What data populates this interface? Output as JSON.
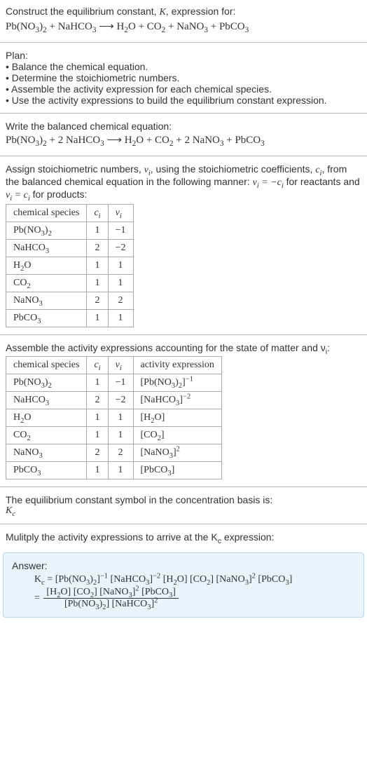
{
  "intro": {
    "line1_prefix": "Construct the equilibrium constant, ",
    "K": "K",
    "line1_suffix": ", expression for:",
    "equation": "Pb(NO<sub>3</sub>)<sub>2</sub> + NaHCO<sub>3</sub>  ⟶  H<sub>2</sub>O + CO<sub>2</sub> + NaNO<sub>3</sub> + PbCO<sub>3</sub>"
  },
  "plan": {
    "heading": "Plan:",
    "items": [
      "• Balance the chemical equation.",
      "• Determine the stoichiometric numbers.",
      "• Assemble the activity expression for each chemical species.",
      "• Use the activity expressions to build the equilibrium constant expression."
    ]
  },
  "balanced": {
    "heading": "Write the balanced chemical equation:",
    "equation": "Pb(NO<sub>3</sub>)<sub>2</sub> + 2 NaHCO<sub>3</sub>  ⟶  H<sub>2</sub>O + CO<sub>2</sub> + 2 NaNO<sub>3</sub> + PbCO<sub>3</sub>"
  },
  "stoich_text": {
    "part1": "Assign stoichiometric numbers, ",
    "nu_i": "ν<sub>i</sub>",
    "part2": ", using the stoichiometric coefficients, ",
    "c_i": "c<sub>i</sub>",
    "part3": ", from the balanced chemical equation in the following manner: ",
    "rel1": "ν<sub>i</sub> = −c<sub>i</sub>",
    "part4": " for reactants and ",
    "rel2": "ν<sub>i</sub> = c<sub>i</sub>",
    "part5": " for products:"
  },
  "table1": {
    "headers": [
      "chemical species",
      "c<sub>i</sub>",
      "ν<sub>i</sub>"
    ],
    "rows": [
      [
        "Pb(NO<sub>3</sub>)<sub>2</sub>",
        "1",
        "−1"
      ],
      [
        "NaHCO<sub>3</sub>",
        "2",
        "−2"
      ],
      [
        "H<sub>2</sub>O",
        "1",
        "1"
      ],
      [
        "CO<sub>2</sub>",
        "1",
        "1"
      ],
      [
        "NaNO<sub>3</sub>",
        "2",
        "2"
      ],
      [
        "PbCO<sub>3</sub>",
        "1",
        "1"
      ]
    ]
  },
  "activity_heading": "Assemble the activity expressions accounting for the state of matter and ν<sub>i</sub>:",
  "table2": {
    "headers": [
      "chemical species",
      "c<sub>i</sub>",
      "ν<sub>i</sub>",
      "activity expression"
    ],
    "rows": [
      [
        "Pb(NO<sub>3</sub>)<sub>2</sub>",
        "1",
        "−1",
        "[Pb(NO<sub>3</sub>)<sub>2</sub>]<sup>−1</sup>"
      ],
      [
        "NaHCO<sub>3</sub>",
        "2",
        "−2",
        "[NaHCO<sub>3</sub>]<sup>−2</sup>"
      ],
      [
        "H<sub>2</sub>O",
        "1",
        "1",
        "[H<sub>2</sub>O]"
      ],
      [
        "CO<sub>2</sub>",
        "1",
        "1",
        "[CO<sub>2</sub>]"
      ],
      [
        "NaNO<sub>3</sub>",
        "2",
        "2",
        "[NaNO<sub>3</sub>]<sup>2</sup>"
      ],
      [
        "PbCO<sub>3</sub>",
        "1",
        "1",
        "[PbCO<sub>3</sub>]"
      ]
    ]
  },
  "eq_symbol": {
    "line1": "The equilibrium constant symbol in the concentration basis is:",
    "symbol": "K<sub>c</sub>"
  },
  "multiply_heading": "Mulitply the activity expressions to arrive at the K<sub>c</sub> expression:",
  "answer": {
    "label": "Answer:",
    "line1": "K<sub>c</sub> = [Pb(NO<sub>3</sub>)<sub>2</sub>]<sup>−1</sup> [NaHCO<sub>3</sub>]<sup>−2</sup> [H<sub>2</sub>O] [CO<sub>2</sub>] [NaNO<sub>3</sub>]<sup>2</sup> [PbCO<sub>3</sub>]",
    "frac_num": "[H<sub>2</sub>O] [CO<sub>2</sub>] [NaNO<sub>3</sub>]<sup>2</sup> [PbCO<sub>3</sub>]",
    "frac_den": "[Pb(NO<sub>3</sub>)<sub>2</sub>] [NaHCO<sub>3</sub>]<sup>2</sup>",
    "equals": "= "
  }
}
